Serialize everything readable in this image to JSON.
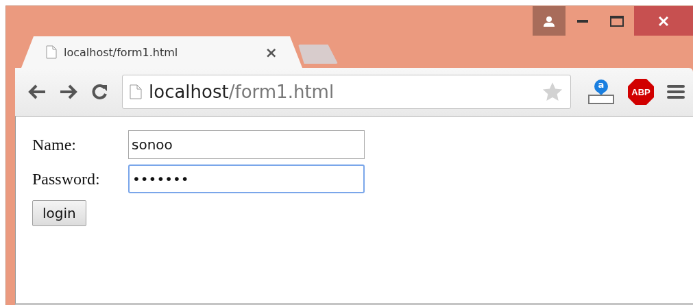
{
  "tabs": [
    {
      "title": "localhost/form1.html",
      "close": "×",
      "selected": true
    }
  ],
  "address_bar": {
    "host": "localhost",
    "path": "/form1.html",
    "bookmarked": false
  },
  "extensions": [
    {
      "kind": "amazon",
      "label": "a"
    },
    {
      "kind": "adblock",
      "label": "ABP"
    }
  ],
  "form": {
    "fields": [
      {
        "label": "Name:",
        "value": "sonoo",
        "focused": false
      },
      {
        "label": "Password:",
        "value": "•••••••",
        "focused": true
      }
    ],
    "button": "login"
  }
}
